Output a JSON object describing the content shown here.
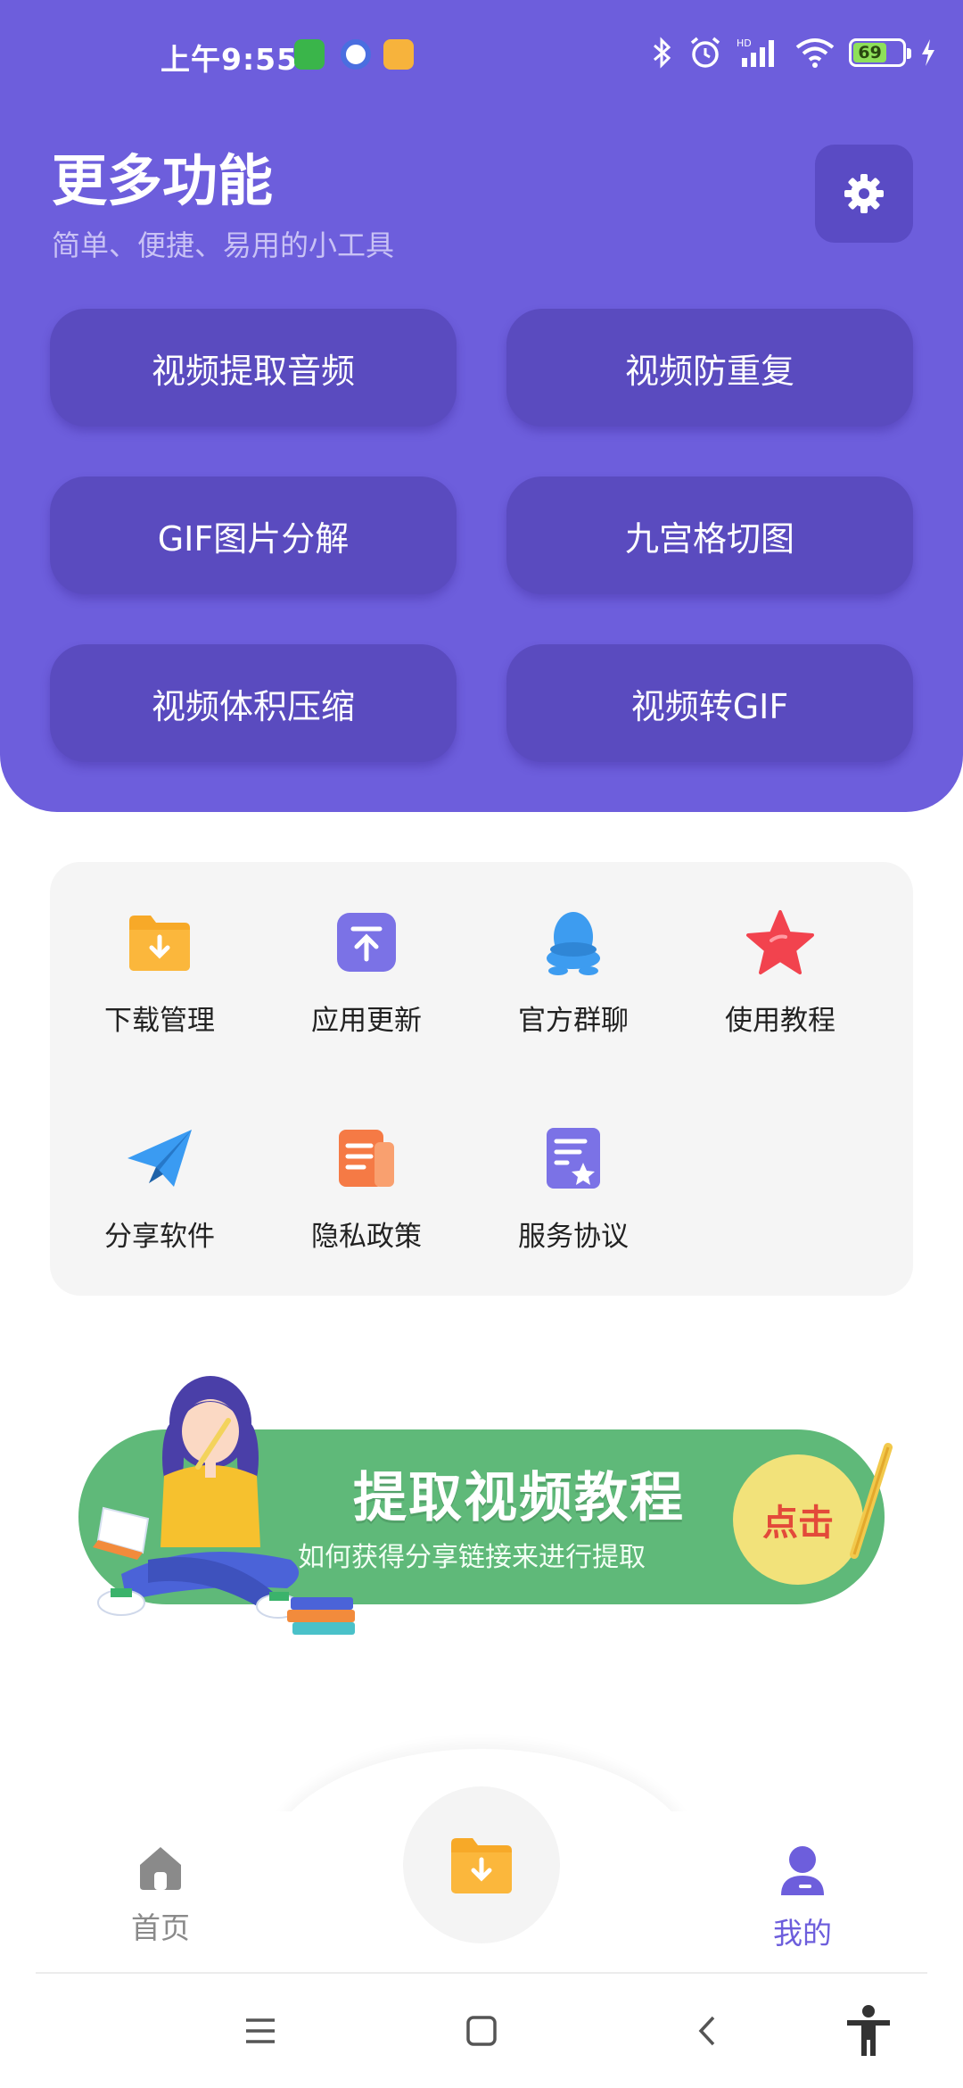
{
  "status_bar": {
    "time": "上午9:55",
    "battery": "69"
  },
  "header": {
    "title": "更多功能",
    "subtitle": "简单、便捷、易用的小工具",
    "settings_icon": "gear-icon"
  },
  "tools": [
    {
      "label": "视频提取音频"
    },
    {
      "label": "视频防重复"
    },
    {
      "label": "GIF图片分解"
    },
    {
      "label": "九宫格切图"
    },
    {
      "label": "视频体积压缩"
    },
    {
      "label": "视频转GIF"
    }
  ],
  "features": [
    {
      "label": "下载管理",
      "icon": "download-folder-icon"
    },
    {
      "label": "应用更新",
      "icon": "upload-icon"
    },
    {
      "label": "官方群聊",
      "icon": "qq-penguin-icon"
    },
    {
      "label": "使用教程",
      "icon": "star-icon"
    },
    {
      "label": "分享软件",
      "icon": "paper-plane-icon"
    },
    {
      "label": "隐私政策",
      "icon": "document-icon"
    },
    {
      "label": "服务协议",
      "icon": "agreement-star-icon"
    }
  ],
  "banner": {
    "title": "提取视频教程",
    "subtitle": "如何获得分享链接来进行提取",
    "button": "点击"
  },
  "bottom_nav": {
    "home": "首页",
    "center_icon": "download-folder-icon",
    "mine": "我的"
  },
  "colors": {
    "primary": "#6D5EDC",
    "tool_button": "#5A4BBF",
    "banner": "#5FB979",
    "active_tab": "#6D5EDC"
  }
}
